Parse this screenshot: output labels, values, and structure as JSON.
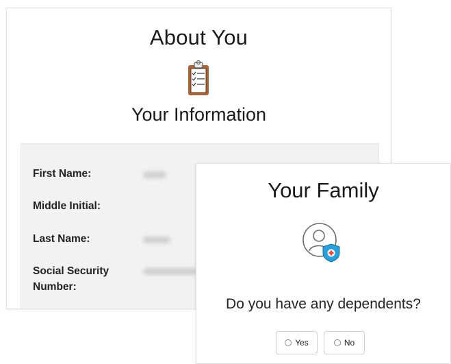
{
  "about": {
    "title": "About You",
    "subtitle": "Your Information",
    "icon": "clipboard-checklist-icon",
    "fields": [
      {
        "label": "First Name:"
      },
      {
        "label": "Middle Initial:"
      },
      {
        "label": "Last Name:"
      },
      {
        "label": "Social Security Number:"
      }
    ]
  },
  "family": {
    "title": "Your Family",
    "icon": "person-shield-icon",
    "question": "Do you have any dependents?",
    "options": [
      "Yes",
      "No"
    ]
  },
  "colors": {
    "panel_bg": "#f2f2f2",
    "shield_blue": "#2b9fd9",
    "clipboard_brown": "#a8643a"
  }
}
